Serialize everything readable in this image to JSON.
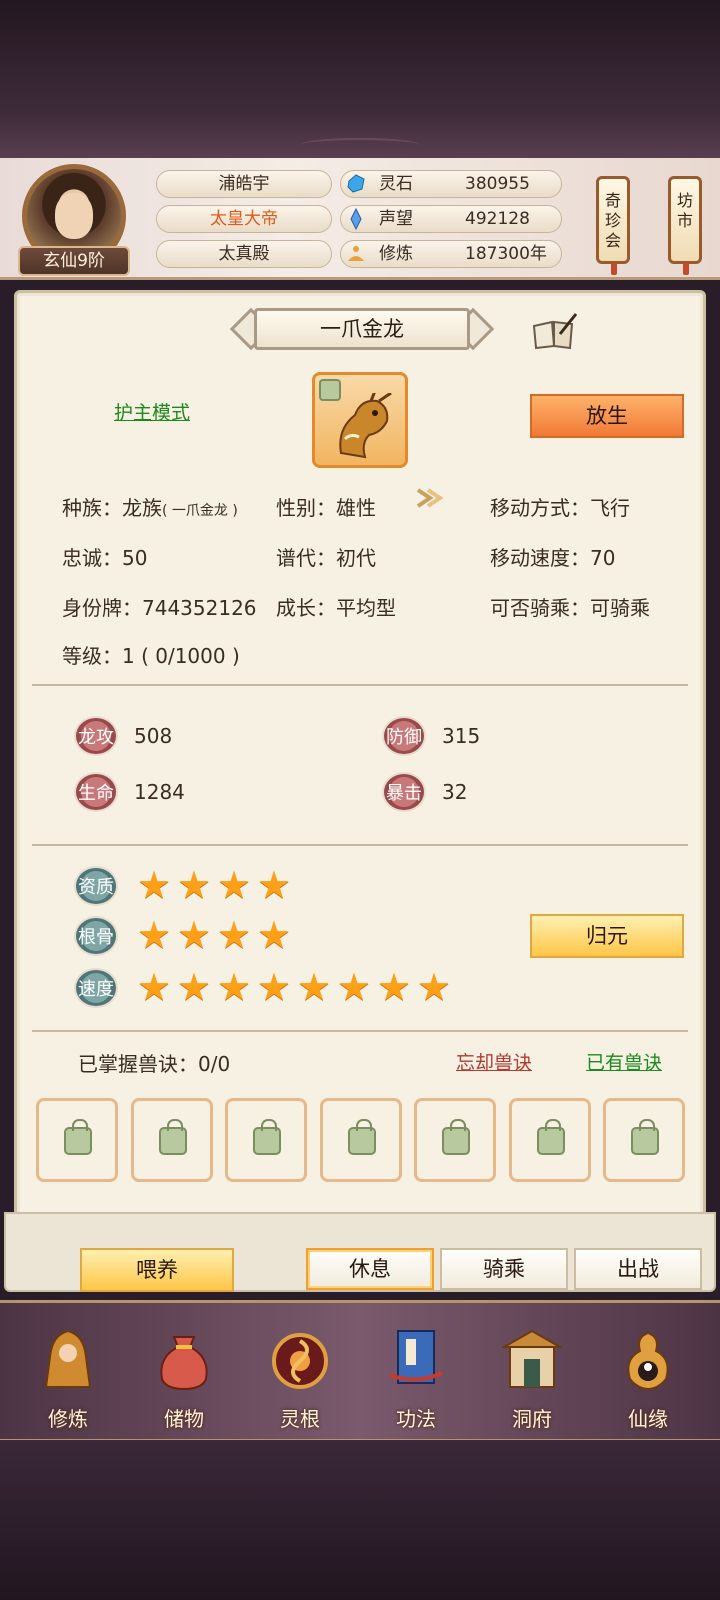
{
  "player": {
    "name": "浦皓宇",
    "title": "太皇大帝",
    "hall": "太真殿",
    "rank": "玄仙9阶"
  },
  "resources": [
    {
      "label": "灵石",
      "value": "380955",
      "icon": "spirit-stone-icon"
    },
    {
      "label": "声望",
      "value": "492128",
      "icon": "prestige-crystal-icon"
    },
    {
      "label": "修炼",
      "value": "187300年",
      "icon": "meditation-icon"
    }
  ],
  "side_buttons": {
    "treasure_fair": "奇珍会",
    "market": "坊市"
  },
  "pet": {
    "name": "一爪金龙",
    "mode_link": "护主模式",
    "release_button": "放生",
    "info": {
      "species_label": "种族：龙族",
      "species_sub": "( 一爪金龙 )",
      "gender": "性别：雄性",
      "movement": "移动方式：飞行",
      "loyalty": "忠诚：50",
      "generation": "谱代：初代",
      "move_speed": "移动速度：70",
      "id_tag": "身份牌：744352126",
      "growth": "成长：平均型",
      "rideable": "可否骑乘：可骑乘",
      "level": "等级：1 ( 0/1000 )"
    },
    "stats": [
      {
        "label": "龙攻",
        "value": "508"
      },
      {
        "label": "防御",
        "value": "315"
      },
      {
        "label": "生命",
        "value": "1284"
      },
      {
        "label": "暴击",
        "value": "32"
      }
    ],
    "aptitudes": [
      {
        "label": "资质",
        "stars": 4
      },
      {
        "label": "根骨",
        "stars": 4
      },
      {
        "label": "速度",
        "stars": 8
      }
    ],
    "return_button": "归元",
    "skills": {
      "mastered": "已掌握兽诀：0/0",
      "forget_link": "忘却兽诀",
      "owned_link": "已有兽诀",
      "locked_slots": 7
    }
  },
  "actions": {
    "feed": "喂养",
    "rest": "休息",
    "ride": "骑乘",
    "battle": "出战",
    "active": "rest"
  },
  "nav": [
    {
      "label": "修炼",
      "icon": "cultivation-icon"
    },
    {
      "label": "储物",
      "icon": "storage-bag-icon"
    },
    {
      "label": "灵根",
      "icon": "spirit-root-icon"
    },
    {
      "label": "功法",
      "icon": "technique-book-icon"
    },
    {
      "label": "洞府",
      "icon": "cave-mansion-icon"
    },
    {
      "label": "仙缘",
      "icon": "immortal-fate-icon"
    }
  ],
  "colors": {
    "accent_orange": "#f07a36",
    "title_orange": "#e05a1a",
    "link_green": "#1d8a1d",
    "link_red": "#b23a30",
    "star": "#ffa018"
  }
}
